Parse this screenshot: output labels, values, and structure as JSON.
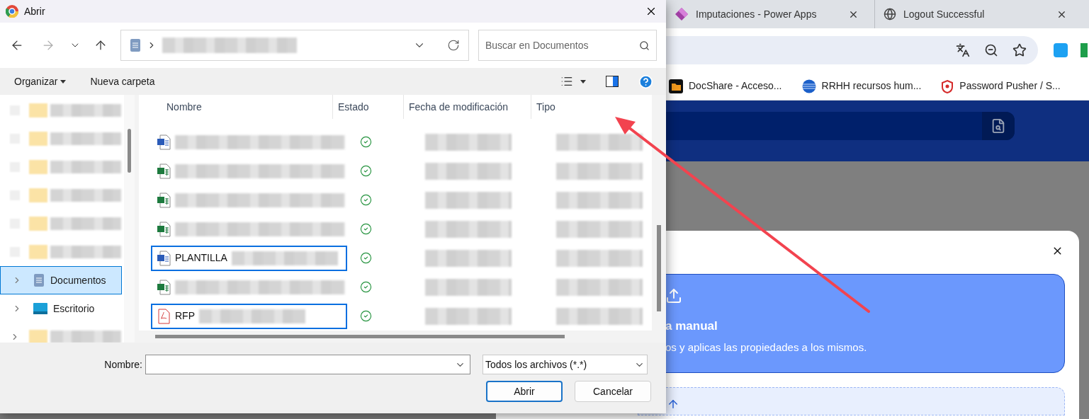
{
  "dialog": {
    "title": "Abrir",
    "search": {
      "placeholder": "Buscar en Documentos"
    },
    "commands": [
      "Organizar",
      "Nueva carpeta"
    ],
    "nav_tree": [
      {
        "kind": "redacted",
        "selected": false,
        "expandable": false
      },
      {
        "kind": "redacted",
        "selected": false,
        "expandable": false
      },
      {
        "kind": "redacted",
        "selected": false,
        "expandable": false
      },
      {
        "kind": "redacted",
        "selected": false,
        "expandable": false
      },
      {
        "kind": "redacted",
        "selected": false,
        "expandable": false
      },
      {
        "kind": "redacted",
        "selected": false,
        "expandable": false
      },
      {
        "kind": "documents",
        "label": "Documentos",
        "selected": true,
        "expandable": true
      },
      {
        "kind": "desktop",
        "label": "Escritorio",
        "selected": false,
        "expandable": true
      },
      {
        "kind": "redacted",
        "selected": false,
        "expandable": true
      }
    ],
    "columns": [
      "Nombre",
      "Estado",
      "Fecha de modificación",
      "Tipo"
    ],
    "rows": [
      {
        "kind": "word",
        "selected": false
      },
      {
        "kind": "excel",
        "selected": false
      },
      {
        "kind": "excel",
        "selected": false
      },
      {
        "kind": "excel",
        "selected": false
      },
      {
        "kind": "word",
        "name": "PLANTILLA",
        "selected": true
      },
      {
        "kind": "excel",
        "selected": false
      },
      {
        "kind": "pdf",
        "name": "RFP",
        "selected": true
      }
    ],
    "filename_label": "Nombre:",
    "filter": "Todos los archivos (*.*)",
    "buttons": [
      {
        "label": "Abrir",
        "default": true
      },
      {
        "label": "Cancelar",
        "default": false
      }
    ]
  },
  "browser": {
    "tabs": [
      {
        "title": "Imputaciones - Power Apps"
      },
      {
        "title": "Logout Successful"
      }
    ],
    "bookmarks": [
      {
        "label": "DocShare - Acceso..."
      },
      {
        "label": "RRHH recursos hum..."
      },
      {
        "label": "Password Pusher / S..."
      }
    ],
    "modal": {
      "option_title": "a manual",
      "option_description": "os y aplicas las propiedades a los mismos."
    }
  }
}
